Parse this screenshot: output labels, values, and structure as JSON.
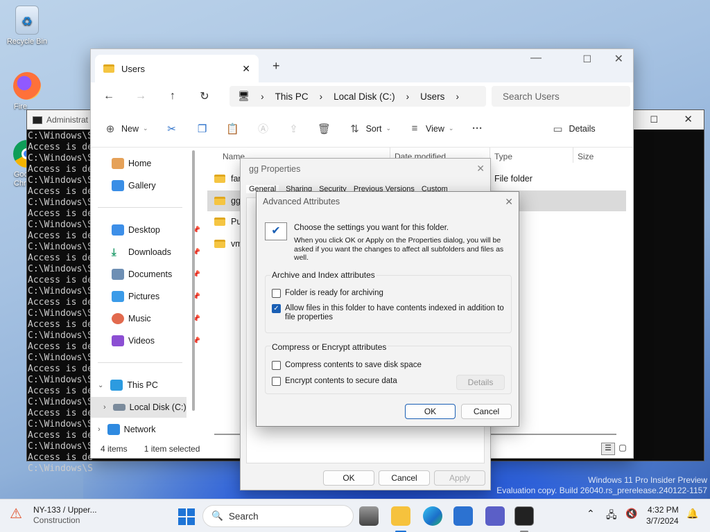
{
  "desktop": {
    "recycle_bin": "Recycle Bin",
    "firefox": "Fire",
    "chrome": "Goo\nChr",
    "watermark_line1": "Windows 11 Pro Insider Preview",
    "watermark_line2": "Evaluation copy. Build 26040.rs_prerelease.240122-1157"
  },
  "console": {
    "title": "Administrat",
    "lines": [
      "C:\\Windows\\S",
      "Access is de",
      "C:\\Windows\\S",
      "Access is de",
      "C:\\Windows\\S",
      "Access is de",
      "C:\\Windows\\S",
      "Access is de",
      "C:\\Windows\\S",
      "Access is de",
      "C:\\Windows\\S",
      "Access is de",
      "C:\\Windows\\S",
      "Access is de",
      "C:\\Windows\\S",
      "Access is de",
      "C:\\Windows\\S",
      "Access is de",
      "C:\\Windows\\S",
      "Access is de",
      "C:\\Windows\\S",
      "Access is de",
      "C:\\Windows\\S",
      "Access is de",
      "C:\\Windows\\S",
      "Access is de",
      "C:\\Windows\\S",
      "Access is de",
      "C:\\Windows\\S",
      "Access is de",
      "C:\\Windows\\S"
    ]
  },
  "explorer": {
    "tab_title": "Users",
    "breadcrumb": [
      "This PC",
      "Local Disk (C:)",
      "Users"
    ],
    "search_placeholder": "Search Users",
    "cmd": {
      "new": "New",
      "sort": "Sort",
      "view": "View",
      "details": "Details"
    },
    "sidebar": {
      "home": "Home",
      "gallery": "Gallery",
      "desktop": "Desktop",
      "downloads": "Downloads",
      "documents": "Documents",
      "pictures": "Pictures",
      "music": "Music",
      "videos": "Videos",
      "this_pc": "This PC",
      "local_disk": "Local Disk (C:)",
      "network": "Network"
    },
    "columns": {
      "name": "Name",
      "date": "Date modified",
      "type": "Type",
      "size": "Size"
    },
    "files": [
      {
        "name": "fart",
        "type": "File folder"
      },
      {
        "name": "gg",
        "type": "lder"
      },
      {
        "name": "Pub",
        "type": "lder"
      },
      {
        "name": "vmu",
        "type": "lder"
      }
    ],
    "status": {
      "items": "4 items",
      "selected": "1 item selected"
    }
  },
  "props": {
    "title": "gg Properties",
    "tabs": [
      "General",
      "Sharing",
      "Security",
      "Previous Versions",
      "Customize"
    ],
    "ok": "OK",
    "cancel": "Cancel",
    "apply": "Apply"
  },
  "advanced": {
    "title": "Advanced Attributes",
    "intro": "Choose the settings you want for this folder.",
    "intro2": "When you click OK or Apply on the Properties dialog, you will be asked if you want the changes to affect all subfolders and files as well.",
    "archive_group": "Archive and Index attributes",
    "archiving": "Folder is ready for archiving",
    "indexing": "Allow files in this folder to have contents indexed in addition to file properties",
    "compress_group": "Compress or Encrypt attributes",
    "compress": "Compress contents to save disk space",
    "encrypt": "Encrypt contents to secure data",
    "details": "Details",
    "ok": "OK",
    "cancel": "Cancel",
    "checked": {
      "archiving": false,
      "indexing": true,
      "compress": false,
      "encrypt": false
    }
  },
  "taskbar": {
    "weather_title": "NY-133 / Upper...",
    "weather_sub": "Construction",
    "search": "Search",
    "time": "4:32 PM",
    "date": "3/7/2024"
  }
}
